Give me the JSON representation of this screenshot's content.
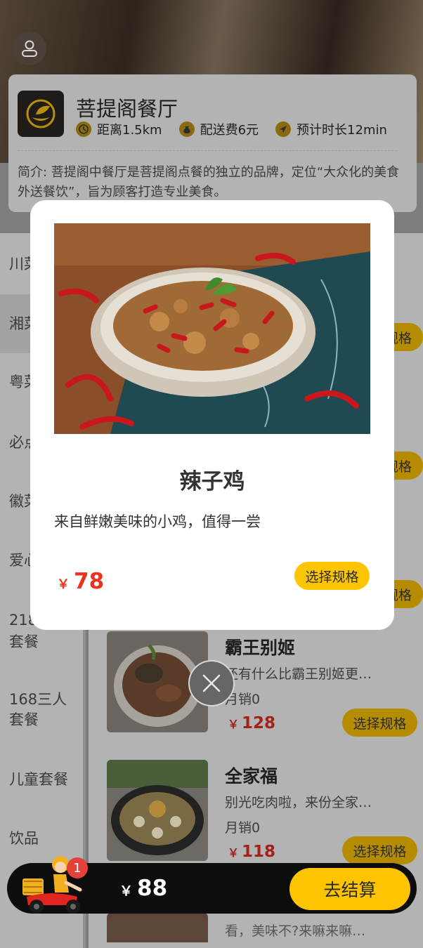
{
  "restaurant": {
    "name": "菩提阁餐厅",
    "distance": "距离1.5km",
    "delivery_fee": "配送费6元",
    "eta": "预计时长12min",
    "intro": "简介: 菩提阁中餐厅是菩提阁点餐的独立的品牌，定位“大众化的美食外送餐饮”，旨为顾客打造专业美食。"
  },
  "categories": [
    "川菜",
    "湘菜",
    "粤菜",
    "必点",
    "徽菜",
    "爱心",
    "218套餐",
    "168三人套餐",
    "儿童套餐",
    "饮品"
  ],
  "categories_visible": [
    "川菜",
    "湘菜",
    "粤菜",
    "必点",
    "徽菜",
    "爱心",
    "218\n套餐",
    "168三人\n套餐",
    "儿童套餐",
    "饮品"
  ],
  "spec_label": "选择规格",
  "spec_partial": "规格",
  "dishes": [
    {
      "name": "霸王别姬",
      "desc": "还有什么比霸王别姬更…",
      "sold": "月销0",
      "currency": "￥",
      "price": "128"
    },
    {
      "name": "全家福",
      "desc": "别光吃肉啦，来份全家…",
      "sold": "月销0",
      "currency": "￥",
      "price": "118"
    }
  ],
  "partial_dish_desc": "看，美味不?来嘛来嘛…",
  "modal": {
    "title": "辣子鸡",
    "description": "来自鲜嫩美味的小鸡，值得一尝",
    "currency": "￥",
    "price": "78",
    "spec_label": "选择规格"
  },
  "cart": {
    "badge_count": "1",
    "currency": "￥",
    "total": "88",
    "checkout_label": "去结算"
  },
  "colors": {
    "accent": "#fdc400",
    "price_red": "#e8331f",
    "badge_red": "#e5413a",
    "cart_bg": "#0d0d0d"
  },
  "icons": [
    "user-icon",
    "clock-icon",
    "money-bag-icon",
    "navigation-icon",
    "close-icon",
    "delivery-courier-icon"
  ]
}
